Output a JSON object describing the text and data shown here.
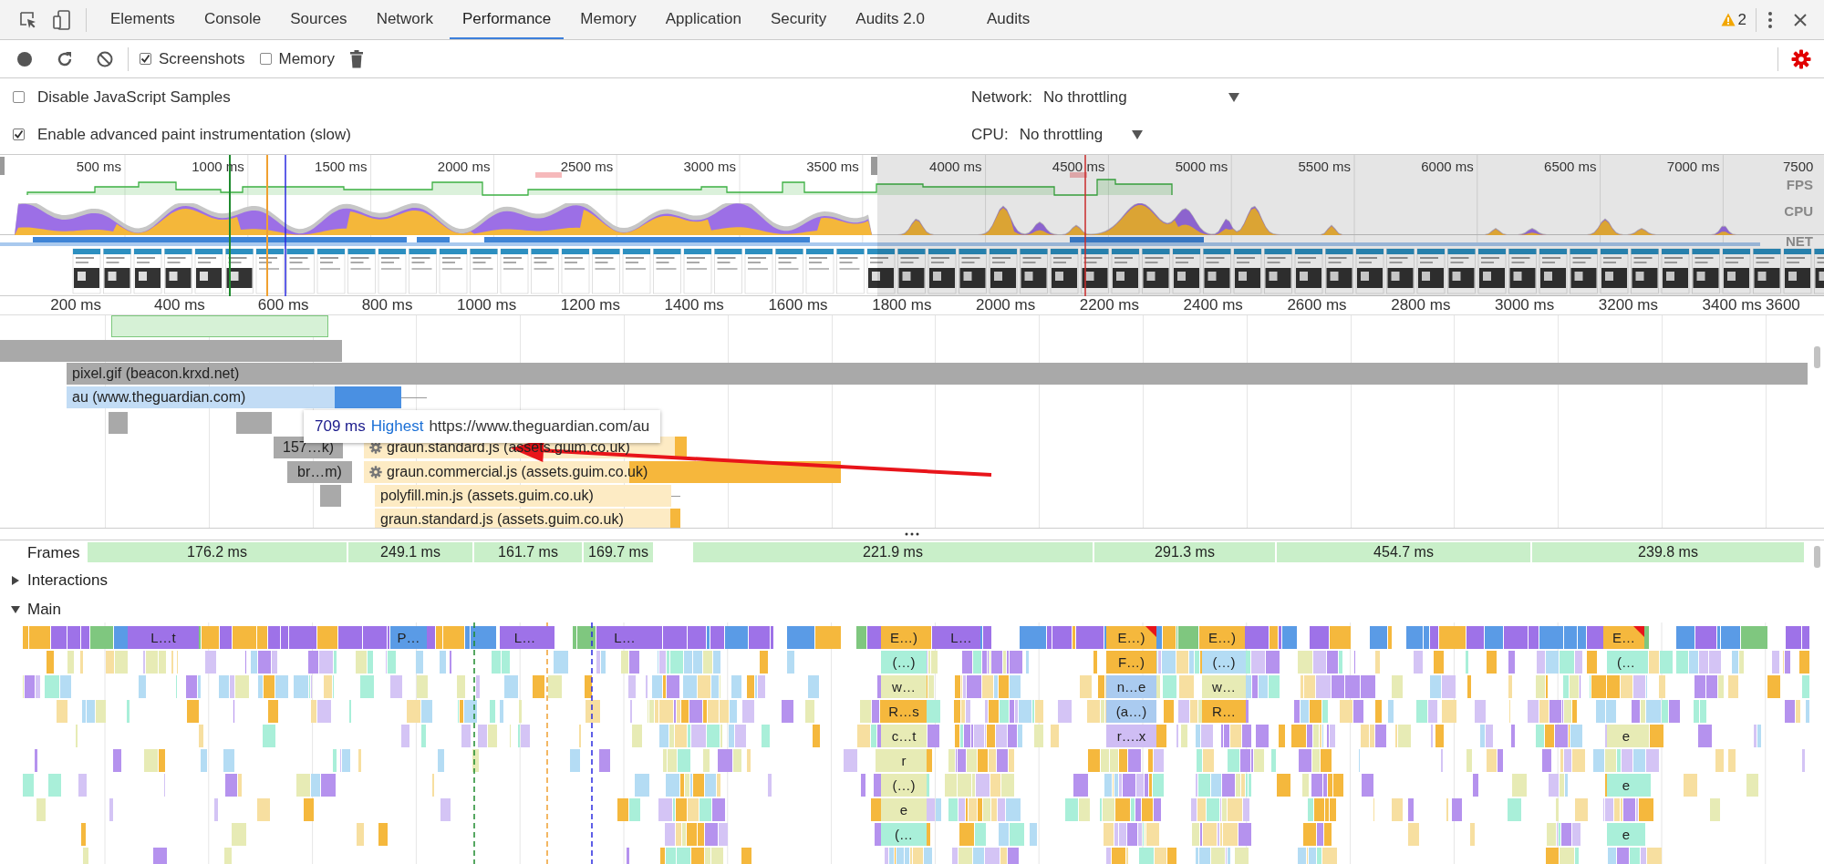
{
  "tabs": [
    {
      "label": "Elements",
      "selected": false
    },
    {
      "label": "Console",
      "selected": false
    },
    {
      "label": "Sources",
      "selected": false
    },
    {
      "label": "Network",
      "selected": false
    },
    {
      "label": "Performance",
      "selected": true
    },
    {
      "label": "Memory",
      "selected": false
    },
    {
      "label": "Application",
      "selected": false
    },
    {
      "label": "Security",
      "selected": false
    },
    {
      "label": "Audits 2.0",
      "selected": false
    },
    {
      "label": "Audits",
      "selected": false
    }
  ],
  "warnings": {
    "count": "2"
  },
  "toolbar": {
    "screenshots": {
      "label": "Screenshots",
      "checked": true
    },
    "memory": {
      "label": "Memory",
      "checked": false
    }
  },
  "settings": {
    "js_samples": {
      "label": "Disable JavaScript Samples",
      "checked": false
    },
    "paint": {
      "label": "Enable advanced paint instrumentation (slow)",
      "checked": true
    },
    "network": {
      "label": "Network:",
      "value": "No throttling"
    },
    "cpu": {
      "label": "CPU:",
      "value": "No throttling"
    }
  },
  "overview": {
    "ticks": [
      "500 ms",
      "1000 ms",
      "1500 ms",
      "2000 ms",
      "2500 ms",
      "3000 ms",
      "3500 ms",
      "4000 ms",
      "4500 ms",
      "5000 ms",
      "5500 ms",
      "6000 ms",
      "6500 ms",
      "7000 ms",
      "7500"
    ],
    "lanes": [
      "FPS",
      "CPU",
      "NET"
    ]
  },
  "timeline": {
    "ticks": [
      "200 ms",
      "400 ms",
      "600 ms",
      "800 ms",
      "1000 ms",
      "1200 ms",
      "1400 ms",
      "1600 ms",
      "1800 ms",
      "2000 ms",
      "2200 ms",
      "2400 ms",
      "2600 ms",
      "2800 ms",
      "3000 ms",
      "3200 ms",
      "3400 ms",
      "3600"
    ]
  },
  "requests": [
    {
      "label": "pixel.gif (beacon.krxd.net)",
      "kind": "image",
      "gear": false
    },
    {
      "label": "au (www.theguardian.com)",
      "kind": "document",
      "gear": false
    },
    {
      "label": "157…k)",
      "kind": "other",
      "gear": false
    },
    {
      "label": "graun.standard.js (assets.guim.co.uk)",
      "kind": "script",
      "gear": true
    },
    {
      "label": "br…m)",
      "kind": "other",
      "gear": false
    },
    {
      "label": "graun.commercial.js (assets.guim.co.uk)",
      "kind": "script",
      "gear": true
    },
    {
      "label": "polyfill.min.js (assets.guim.co.uk)",
      "kind": "script",
      "gear": false
    },
    {
      "label": "graun.standard.js (assets.guim.co.uk)",
      "kind": "script",
      "gear": false
    }
  ],
  "tooltip": {
    "duration": "709 ms",
    "priority": "Highest",
    "url": "https://www.theguardian.com/au"
  },
  "frames": {
    "label": "Frames",
    "durations": [
      "176.2 ms",
      "249.1 ms",
      "161.7 ms",
      "169.7 ms",
      "221.9 ms",
      "291.3 ms",
      "454.7 ms",
      "239.8 ms"
    ]
  },
  "tracks": [
    {
      "label": "Interactions",
      "expanded": false
    },
    {
      "label": "Main",
      "expanded": true
    }
  ],
  "main_rows": [
    [
      {
        "label": "L…t",
        "color": "#9e72e8",
        "long_task": false
      },
      {
        "label": "P…",
        "color": "#5a9be6",
        "long_task": false
      },
      {
        "label": "L…",
        "color": "#9e72e8",
        "long_task": false
      },
      {
        "label": "L…",
        "color": "#9e72e8",
        "long_task": false
      },
      {
        "label": "E…)",
        "color": "#f5b83d",
        "long_task": false
      },
      {
        "label": "L…",
        "color": "#9e72e8",
        "long_task": false
      },
      {
        "label": "E…)",
        "color": "#f5b83d",
        "long_task": true
      },
      {
        "label": "E…)",
        "color": "#f5b83d",
        "long_task": false
      },
      {
        "label": "E…",
        "color": "#f5b83d",
        "long_task": true
      }
    ],
    [
      {
        "label": "(…)",
        "color": "#a9efd9"
      },
      {
        "label": "F…)",
        "color": "#f5b83d"
      },
      {
        "label": "(…)",
        "color": "#b4dcf4"
      },
      {
        "label": "(…",
        "color": "#a9efd9"
      }
    ],
    [
      {
        "label": "w…",
        "color": "#e7ebb5"
      },
      {
        "label": "n…e",
        "color": "#aacbf0"
      },
      {
        "label": "w…",
        "color": "#e7ebb5"
      }
    ],
    [
      {
        "label": "R…s",
        "color": "#f5b83d"
      },
      {
        "label": "(a…)",
        "color": "#aacbf0"
      },
      {
        "label": "R…",
        "color": "#f5b83d"
      }
    ],
    [
      {
        "label": "c…t",
        "color": "#e7ebb5"
      },
      {
        "label": "r….x",
        "color": "#cfbdf4"
      },
      {
        "label": "e",
        "color": "#e7ebb5"
      }
    ],
    [
      {
        "label": "r",
        "color": "#e7ebb5"
      }
    ],
    [
      {
        "label": "(…)",
        "color": "#e7ebb5"
      },
      {
        "label": "e",
        "color": "#a9efd9"
      }
    ],
    [
      {
        "label": "e",
        "color": "#e7ebb5"
      }
    ],
    [
      {
        "label": "(…",
        "color": "#a9efd9"
      },
      {
        "label": "e",
        "color": "#a9efd9"
      }
    ]
  ]
}
